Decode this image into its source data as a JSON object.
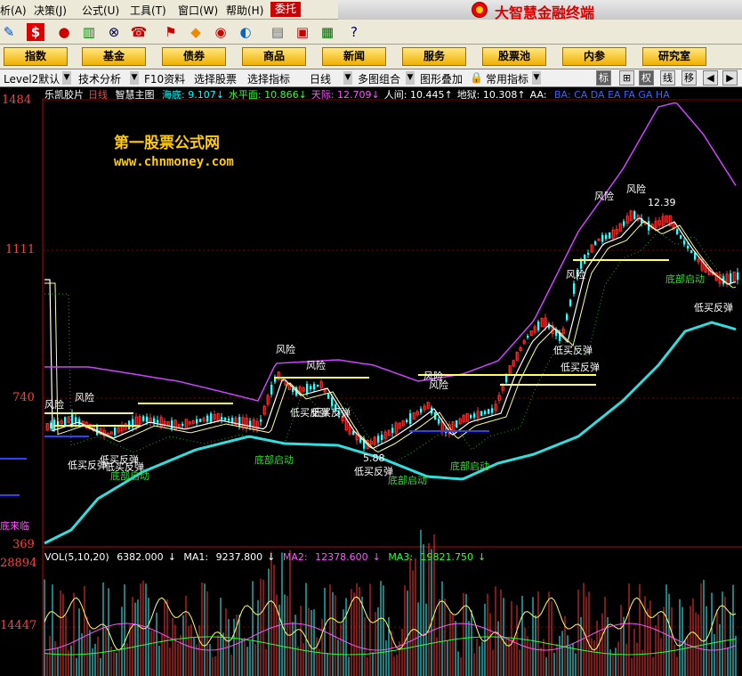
{
  "menu": {
    "items": [
      "析(A)",
      "决策(J)",
      "公式(U)",
      "工具(T)",
      "窗口(W)",
      "帮助(H)"
    ],
    "commission": "委托",
    "brand": "大智慧金融终端"
  },
  "nav": {
    "buttons": [
      "指数",
      "基金",
      "债券",
      "商品",
      "新闻",
      "服务",
      "股票池",
      "内参",
      "研究室"
    ]
  },
  "tabs": {
    "items": [
      "Level2默认",
      "技术分析",
      "F10资料",
      "选择股票",
      "选择指标",
      "日线",
      "多图组合",
      "图形叠加",
      "常用指标"
    ],
    "right_buttons": [
      "标",
      "⊞",
      "权",
      "线",
      "移"
    ]
  },
  "header": {
    "stock": "乐凯胶片",
    "period": "日线",
    "indicator": "智慧主图",
    "fields": [
      {
        "label": "海底:",
        "value": "9.107",
        "arrow": "↓",
        "color": "#00ffff"
      },
      {
        "label": "水平面:",
        "value": "10.866",
        "arrow": "↓",
        "color": "#33ff33"
      },
      {
        "label": "天际:",
        "value": "12.709",
        "arrow": "↓",
        "color": "#ff55ff"
      },
      {
        "label": "人间:",
        "value": "10.445",
        "arrow": "↑",
        "color": "#ffffff"
      },
      {
        "label": "地狱:",
        "value": "10.308",
        "arrow": "↑",
        "color": "#ffffff"
      },
      {
        "label": "AA:",
        "value": "",
        "arrow": "",
        "color": "#ffffff"
      },
      {
        "label": "BA:",
        "value": "CA DA EA FA GA HA",
        "arrow": "",
        "color": "#4060ff"
      }
    ]
  },
  "axis": {
    "price_labels": [
      "1484",
      "1111",
      "740",
      "369"
    ],
    "vol_labels": [
      "28894",
      "14447"
    ]
  },
  "watermark": {
    "title": "第一股票公式网",
    "url": "www.chnmoney.com"
  },
  "signals": {
    "risk": "风险",
    "buy": "低买反弹",
    "bottom": "底部启动",
    "high_value": "12.39",
    "low_value": "5.88",
    "side": "底来临"
  },
  "vol": {
    "name": "VOL(5,10,20)",
    "value": "6382.000",
    "ma1_label": "MA1:",
    "ma1": "9237.800",
    "ma2_label": "MA2:",
    "ma2": "12378.600",
    "ma3_label": "MA3:",
    "ma3": "19821.750"
  },
  "colors": {
    "up": "#ff3333",
    "down": "#33ffff",
    "sky": "#cc44ff",
    "sea": "#33dddd",
    "level": "#ffff66"
  }
}
